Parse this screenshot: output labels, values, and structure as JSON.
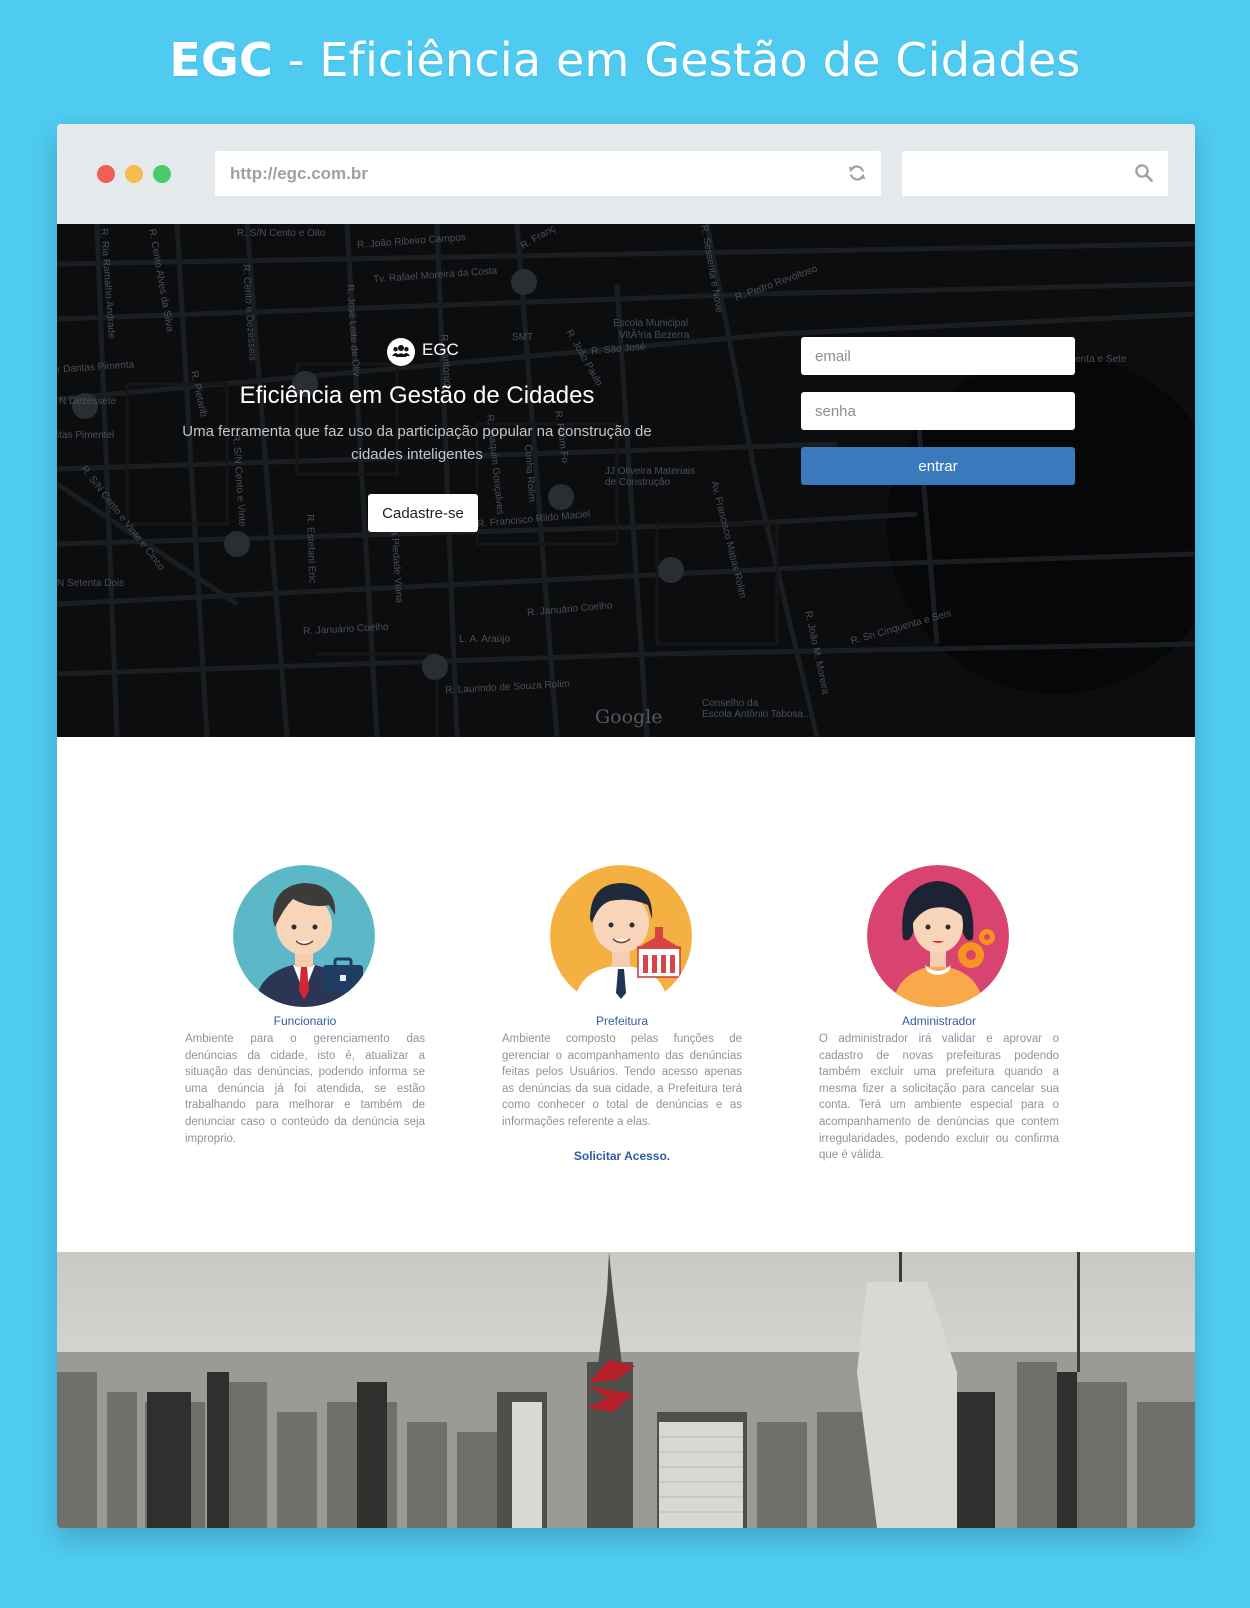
{
  "page": {
    "title_bold": "EGC",
    "title_rest": " - Eficiência em Gestão de Cidades",
    "background_color": "#4fcaf0"
  },
  "browser": {
    "url": "http://egc.com.br",
    "search_value": "",
    "icons": [
      "reload-icon",
      "search-icon"
    ]
  },
  "hero": {
    "brand_icon": "users-icon",
    "brand_name": "EGC",
    "title": "Eficiência em Gestão de Cidades",
    "subtitle": "Uma ferramenta que faz uso da participação popular na construção de cidades inteligentes",
    "signup_label": "Cadastre-se",
    "login": {
      "email_placeholder": "email",
      "password_placeholder": "senha",
      "submit_label": "entrar",
      "accent_color": "#3a7abc"
    },
    "map_labels": [
      "R. S/N Cento e Oito",
      "R. João Ribeiro Campos",
      "Tv. Rafael Moreira da Costa",
      "R. Pedro Revoltoso",
      "Escola Municipal",
      "VitÃ³ria Bezerra",
      "SMT",
      "R. São José",
      "Sessenta e Sete",
      "r Dantas Pimenta",
      "N Dezessete",
      "itas Pimentel",
      "R. Estefani Eric",
      "JJ Oliveira Materiais",
      "de Construção",
      "R. Francisco Rildo Maciel",
      "N Setenta Dois",
      "R. Januário Coelho",
      "R. Januário Coelho",
      "L. A. Araújo",
      "R. Laurindo de Souza Rolim",
      "R. João M. Moreira",
      "R. Sn Cinquenta e Seis",
      "Conselho da",
      "Escola Antônio Tabosa...",
      "Av. Francisco Matias Rolim",
      "R. Ria Ramalho Andrade",
      "R. Cento Alves da Silva",
      "R. Cento e Dezesseis",
      "R. José Leite de Oliv",
      "R. S/N Cento e Vinte",
      "R. S/N Cento e Vinte e Cinco",
      "R. Sessenta e Nove",
      "da Piedade Viana",
      "R. Rolim Fo",
      "Cunha Rolim",
      "R. João Paulo",
      "R. Franç",
      "R. Pietarib",
      "R. Joaquim Gonçalves",
      "R. Fantonio"
    ],
    "google_mark": "Google"
  },
  "roles": [
    {
      "name": "Funcionario",
      "avatar": "employee-avatar",
      "description": "Ambiente para o gerenciamento das denúncias da cidade, isto é, atualizar a situação das denúncias, podendo informa se uma denúncia já foi atendida, se estão trabalhando para melhorar e também de denunciar caso o conteúdo da denúncia seja improprio."
    },
    {
      "name": "Prefeitura",
      "avatar": "city-hall-avatar",
      "description": "Ambiente composto pelas funções de gerenciar o acompanhamento das denúncias feitas pelos Usuários. Tendo acesso apenas as denúncias da sua cidade, a Prefeitura terá como conhecer o total de denúncias e as informações referente a elas.",
      "link": "Solicitar Acesso."
    },
    {
      "name": "Administrador",
      "avatar": "administrator-avatar",
      "description": "O administrador irá validar e aprovar o cadastro de novas prefeituras podendo também excluir uma prefeitura quando a mesma fizer a solicitação para cancelar sua conta. Terá um ambiente especial para o acompanhamento de denúncias que contem irregularidades, podendo excluir ou confirma que é válida."
    }
  ],
  "footer": {
    "logo_icon": "s-logo-icon",
    "logo_color": "#b5202b"
  }
}
